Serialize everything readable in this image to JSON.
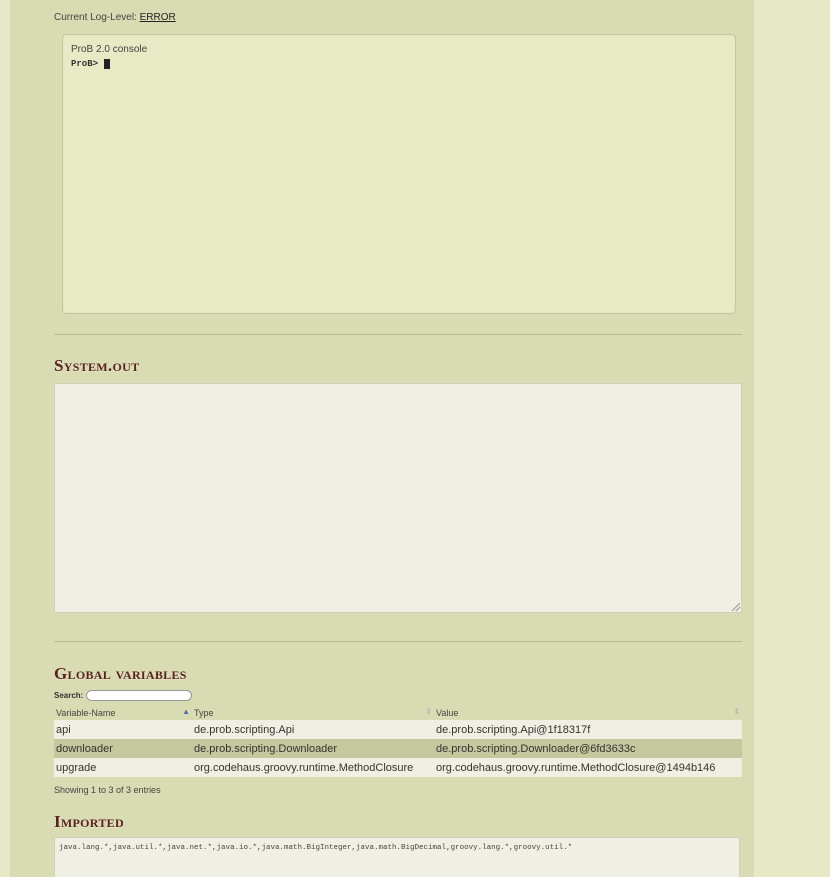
{
  "log_level": {
    "label": "Current Log-Level: ",
    "value": "ERROR"
  },
  "console": {
    "title": "ProB 2.0 console",
    "prompt": "ProB>"
  },
  "system_out": {
    "title": "System.out",
    "content": ""
  },
  "global_variables": {
    "title": "Global variables",
    "search_label": "Search:",
    "search_value": "",
    "columns": [
      "Variable-Name",
      "Type",
      "Value"
    ],
    "rows": [
      {
        "name": "api",
        "type": "de.prob.scripting.Api",
        "value": "de.prob.scripting.Api@1f18317f"
      },
      {
        "name": "downloader",
        "type": "de.prob.scripting.Downloader",
        "value": "de.prob.scripting.Downloader@6fd3633c"
      },
      {
        "name": "upgrade",
        "type": "org.codehaus.groovy.runtime.MethodClosure",
        "value": "org.codehaus.groovy.runtime.MethodClosure@1494b146"
      }
    ],
    "info": "Showing 1 to 3 of 3 entries"
  },
  "imported": {
    "title": "Imported",
    "content": "java.lang.*,java.util.*,java.net.*,java.io.*,java.math.BigInteger,java.math.BigDecimal,groovy.lang.*,groovy.util.*"
  },
  "icons": {
    "sort_ascending": "sort-ascending-icon",
    "sort_both": "sort-both-icon",
    "resize_grip": "resize-grip-icon"
  },
  "colors": {
    "background": "#e7e9c6",
    "panel": "#d9dbb2",
    "heading": "#5a1f1f",
    "row_highlight": "#c5c79d"
  }
}
